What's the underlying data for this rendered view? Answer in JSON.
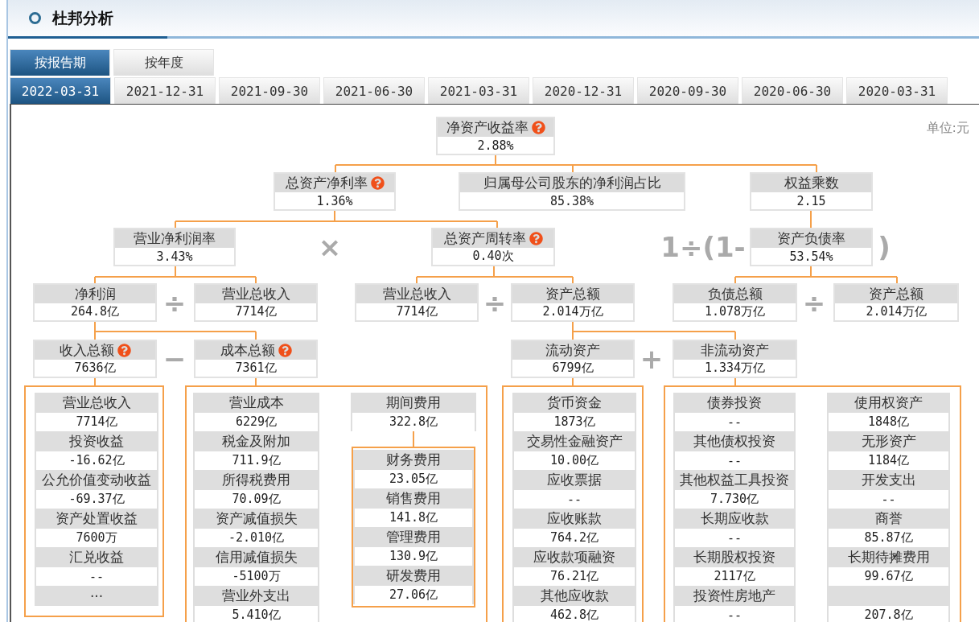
{
  "title": "杜邦分析",
  "mode_tabs": [
    {
      "label": "按报告期",
      "selected": true
    },
    {
      "label": "按年度",
      "selected": false
    }
  ],
  "period_tabs": [
    {
      "label": "2022-03-31",
      "selected": true
    },
    {
      "label": "2021-12-31",
      "selected": false
    },
    {
      "label": "2021-09-30",
      "selected": false
    },
    {
      "label": "2021-06-30",
      "selected": false
    },
    {
      "label": "2021-03-31",
      "selected": false
    },
    {
      "label": "2020-12-31",
      "selected": false
    },
    {
      "label": "2020-09-30",
      "selected": false
    },
    {
      "label": "2020-06-30",
      "selected": false
    },
    {
      "label": "2020-03-31",
      "selected": false
    }
  ],
  "unit": "单位:元",
  "nodes": [
    {
      "label": "净资产收益率",
      "value": "2.88%",
      "help": true
    },
    {
      "label": "总资产净利率",
      "value": "1.36%",
      "help": true
    },
    {
      "label": "归属母公司股东的净利润占比",
      "value": "85.38%",
      "help": false
    },
    {
      "label": "权益乘数",
      "value": "2.15",
      "help": false
    },
    {
      "label": "营业净利润率",
      "value": "3.43%",
      "help": false
    },
    {
      "label": "总资产周转率",
      "value": "0.40次",
      "help": true
    },
    {
      "label": "资产负债率",
      "value": "53.54%",
      "help": false
    },
    {
      "label": "净利润",
      "value": "264.8亿",
      "help": false
    },
    {
      "label": "营业总收入",
      "value": "7714亿",
      "help": false
    },
    {
      "label": "营业总收入",
      "value": "7714亿",
      "help": false
    },
    {
      "label": "资产总额",
      "value": "2.014万亿",
      "help": false
    },
    {
      "label": "负债总额",
      "value": "1.078万亿",
      "help": false
    },
    {
      "label": "资产总额",
      "value": "2.014万亿",
      "help": false
    },
    {
      "label": "收入总额",
      "value": "7636亿",
      "help": true
    },
    {
      "label": "成本总额",
      "value": "7361亿",
      "help": true
    },
    {
      "label": "流动资产",
      "value": "6799亿",
      "help": false
    },
    {
      "label": "非流动资产",
      "value": "1.334万亿",
      "help": false
    }
  ],
  "operators": [
    "×",
    "÷",
    "÷",
    "1÷(1-",
    ")",
    "÷",
    "−",
    "+"
  ],
  "detail_groups": [
    {
      "columns": [
        {
          "items": [
            {
              "label": "营业总收入",
              "value": "7714亿"
            },
            {
              "label": "投资收益",
              "value": "-16.62亿"
            },
            {
              "label": "公允价值变动收益",
              "value": "-69.37亿"
            },
            {
              "label": "资产处置收益",
              "value": "7600万"
            },
            {
              "label": "汇兑收益",
              "value": "--"
            },
            {
              "label": "···"
            }
          ]
        }
      ]
    },
    {
      "columns": [
        {
          "items": [
            {
              "label": "营业成本",
              "value": "6229亿"
            },
            {
              "label": "税金及附加",
              "value": "711.9亿"
            },
            {
              "label": "所得税费用",
              "value": "70.09亿"
            },
            {
              "label": "资产减值损失",
              "value": "-2.010亿"
            },
            {
              "label": "信用减值损失",
              "value": "-5100万"
            },
            {
              "label": "营业外支出",
              "value": "5.410亿"
            }
          ]
        },
        {
          "items": [
            {
              "label": "期间费用",
              "value": "322.8亿"
            }
          ],
          "sub_items": [
            {
              "label": "财务费用",
              "value": "23.05亿"
            },
            {
              "label": "销售费用",
              "value": "141.8亿"
            },
            {
              "label": "管理费用",
              "value": "130.9亿"
            },
            {
              "label": "研发费用",
              "value": "27.06亿"
            }
          ]
        }
      ]
    },
    {
      "columns": [
        {
          "items": [
            {
              "label": "货币资金",
              "value": "1873亿"
            },
            {
              "label": "交易性金融资产",
              "value": "10.00亿"
            },
            {
              "label": "应收票据",
              "value": "--"
            },
            {
              "label": "应收账款",
              "value": "764.2亿"
            },
            {
              "label": "应收款项融资",
              "value": "76.21亿"
            },
            {
              "label": "其他应收款",
              "value": "462.8亿"
            }
          ]
        }
      ]
    },
    {
      "columns": [
        {
          "items": [
            {
              "label": "债券投资",
              "value": "--"
            },
            {
              "label": "其他债权投资",
              "value": "--"
            },
            {
              "label": "其他权益工具投资",
              "value": "7.730亿"
            },
            {
              "label": "长期应收款",
              "value": "--"
            },
            {
              "label": "长期股权投资",
              "value": "2117亿"
            },
            {
              "label": "投资性房地产",
              "value": "--"
            }
          ]
        },
        {
          "items": [
            {
              "label": "使用权资产",
              "value": "1848亿"
            },
            {
              "label": "无形资产",
              "value": "1184亿"
            },
            {
              "label": "开发支出",
              "value": "--"
            },
            {
              "label": "商誉",
              "value": "85.87亿"
            },
            {
              "label": "长期待摊费用",
              "value": "99.67亿"
            },
            {
              "value": "207.8亿"
            }
          ]
        }
      ]
    }
  ]
}
